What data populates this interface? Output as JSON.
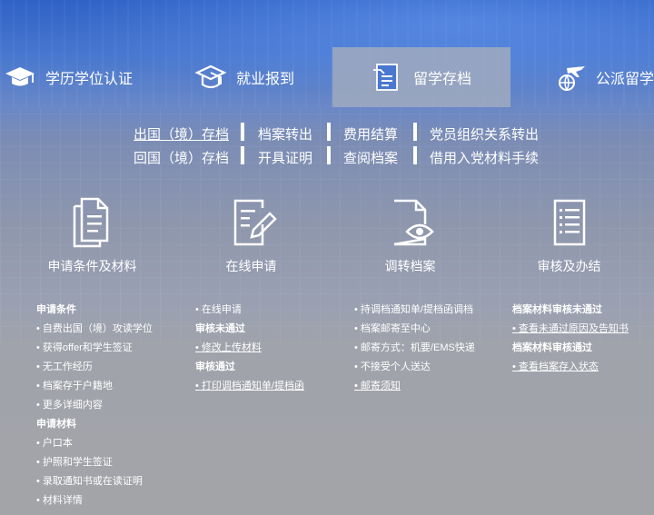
{
  "tabs": [
    {
      "label": "学历学位认证",
      "icon": "graduation-cap-icon"
    },
    {
      "label": "就业报到",
      "icon": "mortarboard-icon"
    },
    {
      "label": "留学存档",
      "icon": "archive-box-icon",
      "active": true
    },
    {
      "label": "公派留学",
      "icon": "airplane-globe-icon"
    }
  ],
  "sublinks": {
    "row1": [
      "出国（境）存档",
      "档案转出",
      "费用结算",
      "党员组织关系转出"
    ],
    "row2": [
      "回国（境）存档",
      "开具证明",
      "查阅档案",
      "借用入党材料手续"
    ]
  },
  "services": [
    {
      "label": "申请条件及材料",
      "icon": "documents-icon"
    },
    {
      "label": "在线申请",
      "icon": "form-edit-icon"
    },
    {
      "label": "调转档案",
      "icon": "file-eye-icon"
    },
    {
      "label": "审核及办结",
      "icon": "checklist-icon"
    }
  ],
  "col1": {
    "h1": "申请条件",
    "items1": [
      "自费出国（境）攻读学位",
      "获得offer和学生签证",
      "无工作经历",
      "档案存于户籍地",
      "更多详细内容"
    ],
    "h2": "申请材料",
    "items2": [
      "户口本",
      "护照和学生签证",
      "录取通知书或在读证明",
      "材料详情"
    ]
  },
  "col2": {
    "item0": "在线申请",
    "h1": "审核未通过",
    "item1": "修改上传材料",
    "h2": "审核通过",
    "item2": "打印调档通知单/提档函"
  },
  "col3": {
    "items": [
      "持调档通知单/提档函调档",
      "档案邮寄至中心",
      "邮寄方式：机要/EMS快递",
      "不接受个人送达",
      "邮寄须知"
    ]
  },
  "col4": {
    "h1": "档案材料审核未通过",
    "item1": "查看未通过原因及告知书",
    "h2": "档案材料审核通过",
    "item2": "查看档案存入状态"
  },
  "colors": {
    "active_tab": "#a0aabe",
    "header_blue": "#3466c8"
  }
}
